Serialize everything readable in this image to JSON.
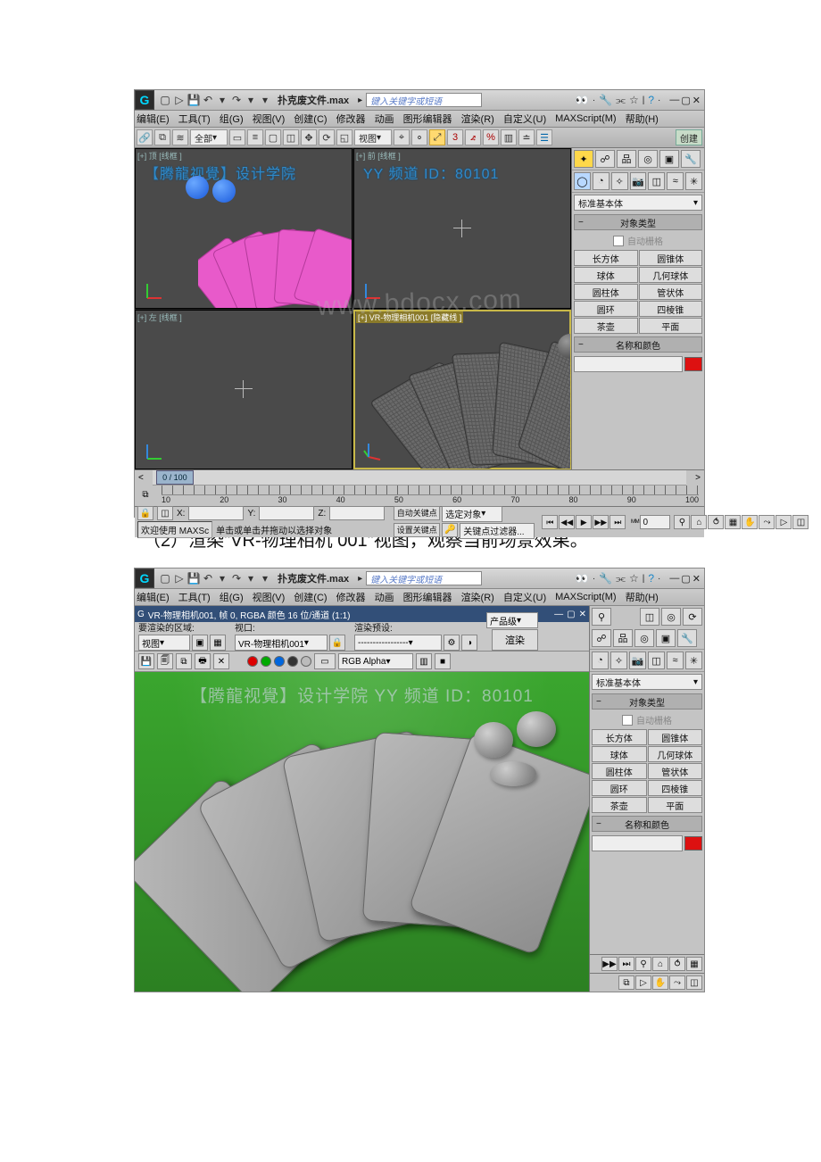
{
  "caption": "（2）渲染\"VR-物理相机 001\"视图，观察当前场景效果。",
  "watermark": "www.bdocx.com",
  "app": {
    "file_name": "扑克废文件.max",
    "search_placeholder": "键入关键字或短语"
  },
  "menu": {
    "edit": "编辑(E)",
    "tools": "工具(T)",
    "group": "组(G)",
    "views": "视图(V)",
    "create": "创建(C)",
    "modifiers": "修改器",
    "animation": "动画",
    "graph_editors": "图形编辑器",
    "rendering": "渲染(R)",
    "customize": "自定义(U)",
    "maxscript": "MAXScript(M)",
    "help": "帮助(H)"
  },
  "toolbar": {
    "all": "全部",
    "view": "视图",
    "create_tab": "创建"
  },
  "panel": {
    "std_primitives": "标准基本体",
    "object_type": "对象类型",
    "auto_grid": "自动栅格",
    "name_color": "名称和颜色",
    "buttons": {
      "box": "长方体",
      "cone": "圆锥体",
      "sphere": "球体",
      "geosphere": "几何球体",
      "cylinder": "圆柱体",
      "tube": "管状体",
      "torus": "圆环",
      "pyramid": "四棱锥",
      "teapot": "茶壶",
      "plane": "平面"
    }
  },
  "panel2": {
    "drop": "标准基本体"
  },
  "viewport": {
    "top_label": "[+] 顶 [线框 ]",
    "front_label": "[+] 前 [线框 ]",
    "left_label": "[+] 左 [线框 ]",
    "cam_label": "[+] VR-物理相机001 [隐藏线 ]",
    "banner_left": "【腾龍视覺】设计学院",
    "banner_right": "YY 频道 ID：80101"
  },
  "timeline": {
    "pos": "0 / 100",
    "ticks": [
      "10",
      "20",
      "30",
      "40",
      "50",
      "60",
      "70",
      "80",
      "90",
      "100"
    ]
  },
  "status": {
    "welcome": "欢迎使用 MAXSc",
    "prompt": "单击或单击并拖动以选择对象",
    "x": "X:",
    "y": "Y:",
    "z": "Z:",
    "auto_key": "自动关键点",
    "set_key": "设置关键点",
    "sel_obj": "选定对象",
    "key_filter": "关键点过滤器...",
    "frame": "0"
  },
  "render_window": {
    "title": "VR-物理相机001, 帧 0, RGBA 颜色 16 位/通道 (1:1)",
    "area_label": "要渲染的区域:",
    "area_value": "视图",
    "viewport_label": "视口:",
    "viewport_value": "VR-物理相机001",
    "preset_label": "渲染预设:",
    "preset_value": "-----------------",
    "product": "产品级",
    "render_btn": "渲染",
    "channel": "RGB Alpha"
  },
  "render_canvas": {
    "banner": "【腾龍视覺】设计学院  YY 频道 ID：80101"
  }
}
